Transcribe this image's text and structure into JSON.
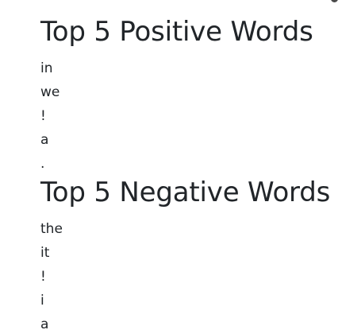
{
  "positive": {
    "title": "Top 5 Positive Words",
    "words": [
      "in",
      "we",
      "!",
      "a",
      "."
    ]
  },
  "negative": {
    "title": "Top 5 Negative Words",
    "words": [
      "the",
      "it",
      "!",
      "i",
      "a"
    ]
  }
}
